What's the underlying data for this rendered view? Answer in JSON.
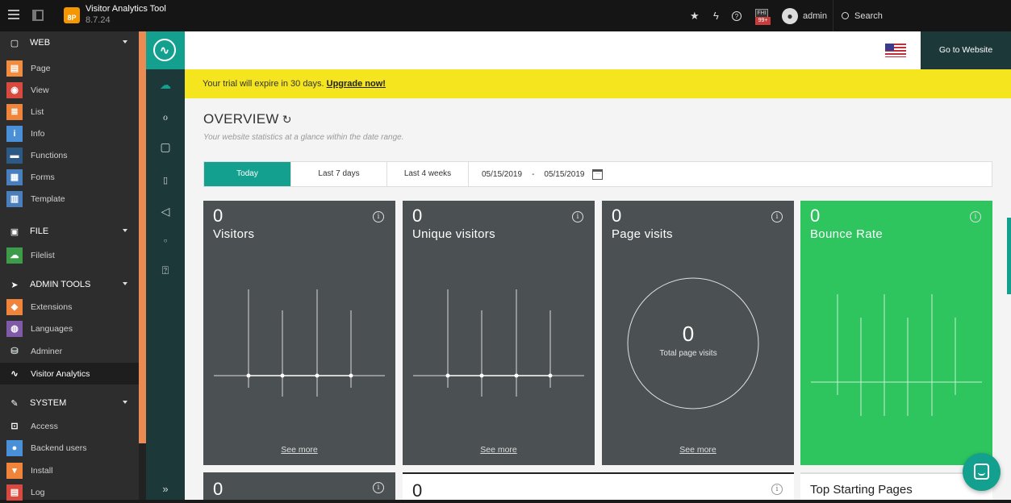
{
  "topbar": {
    "app_title": "Visitor Analytics Tool",
    "version": "8.7.24",
    "logo_text": "8P",
    "notification_badge": "99+",
    "notification_box": "FHI",
    "username": "admin",
    "search_label": "Search"
  },
  "module_menu": {
    "groups": [
      {
        "label": "WEB",
        "items": [
          "Page",
          "View",
          "List",
          "Info",
          "Functions",
          "Forms",
          "Template"
        ]
      },
      {
        "label": "FILE",
        "items": [
          "Filelist"
        ]
      },
      {
        "label": "ADMIN TOOLS",
        "items": [
          "Extensions",
          "Languages",
          "Adminer",
          "Visitor Analytics"
        ]
      },
      {
        "label": "SYSTEM",
        "items": [
          "Access",
          "Backend users",
          "Install",
          "Log"
        ]
      }
    ],
    "active_item": "Visitor Analytics",
    "icon_colors": {
      "Page": "#f28d40",
      "View": "#d84a3f",
      "List": "#f0843a",
      "Info": "#4a90d9",
      "Functions": "#2d5a85",
      "Forms": "#4a7fbd",
      "Template": "#4a7fbd",
      "Filelist": "#3d9c4a",
      "Extensions": "#f0843a",
      "Languages": "#7f5aa8",
      "Access": "#2d2d2d",
      "Backend users": "#4a90d9",
      "Install": "#f0843a",
      "Log": "#d84a3f"
    }
  },
  "header": {
    "goto_label": "Go to Website"
  },
  "trial": {
    "message": "Your trial will expire in 30 days.",
    "upgrade_label": "Upgrade now!"
  },
  "overview": {
    "title": "OVERVIEW",
    "subtitle": "Your website statistics at a glance within the date range.",
    "tabs": [
      "Today",
      "Last 7 days",
      "Last 4 weeks"
    ],
    "active_tab": "Today",
    "date_from": "05/15/2019",
    "date_sep": "-",
    "date_to": "05/15/2019"
  },
  "cards": [
    {
      "value": "0",
      "label": "Visitors",
      "link": "See more"
    },
    {
      "value": "0",
      "label": "Unique visitors",
      "link": "See more"
    },
    {
      "value": "0",
      "label": "Page visits",
      "link": "See more",
      "center_value": "0",
      "center_label": "Total page visits"
    },
    {
      "value": "0",
      "label": "Bounce Rate"
    }
  ],
  "bottom_cards": {
    "card1_value": "0",
    "card2_value": "0",
    "card4_title": "Top Starting Pages"
  },
  "colors": {
    "accent": "#14a08f",
    "card_dark": "#4b5152",
    "card_green": "#2ec55f",
    "trial_bg": "#f4e51e",
    "nav_dark": "#1d3839"
  }
}
